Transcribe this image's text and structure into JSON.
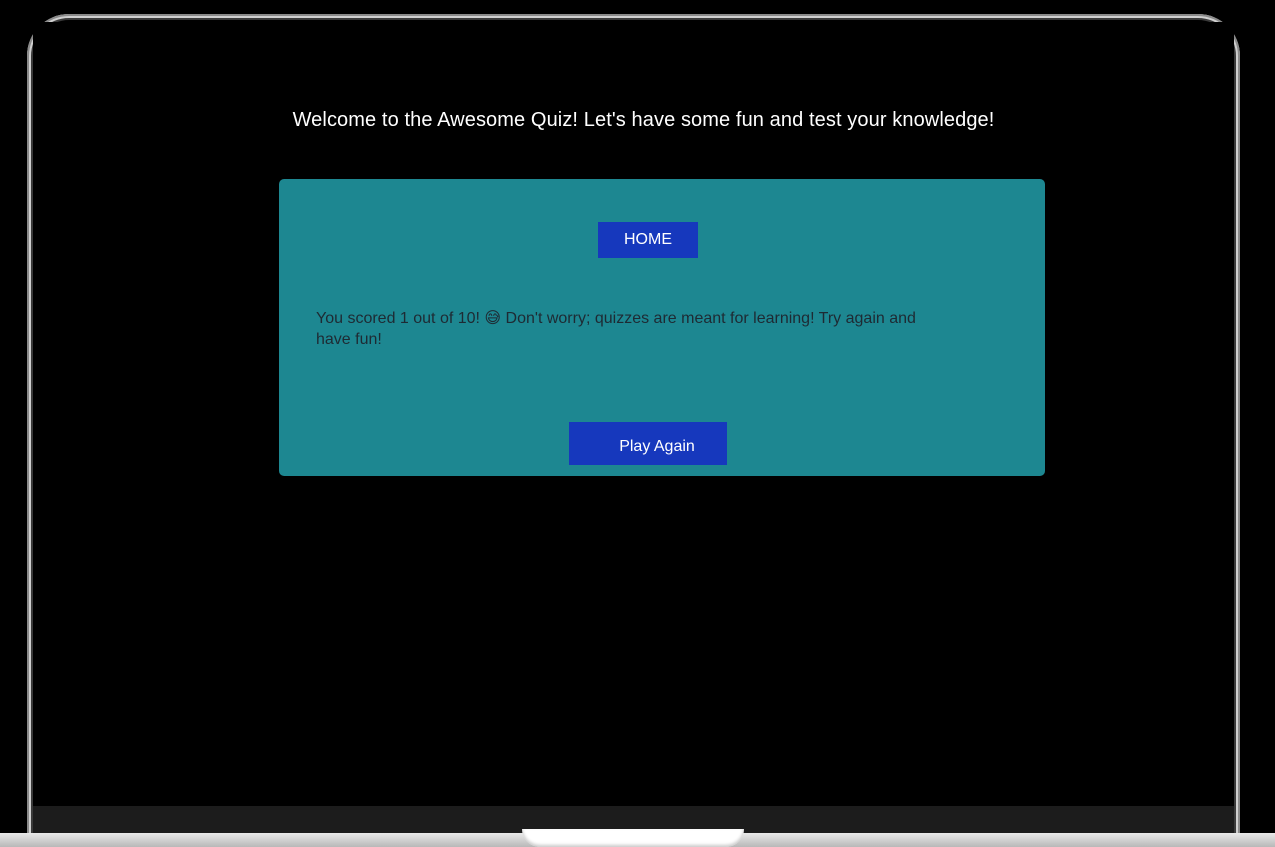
{
  "header": {
    "welcome_text": "Welcome to the Awesome Quiz! Let's have some fun and test your knowledge!"
  },
  "quiz_card": {
    "home_label": "HOME",
    "result_text": "You scored 1 out of 10! 😅 Don't worry; quizzes are meant for learning! Try again and have fun!",
    "play_again_label": "Play Again"
  },
  "colors": {
    "background": "#000000",
    "card": "#1d8791",
    "button": "#1638bd",
    "button_text": "#ffffff",
    "result_text": "#1e2a33"
  }
}
